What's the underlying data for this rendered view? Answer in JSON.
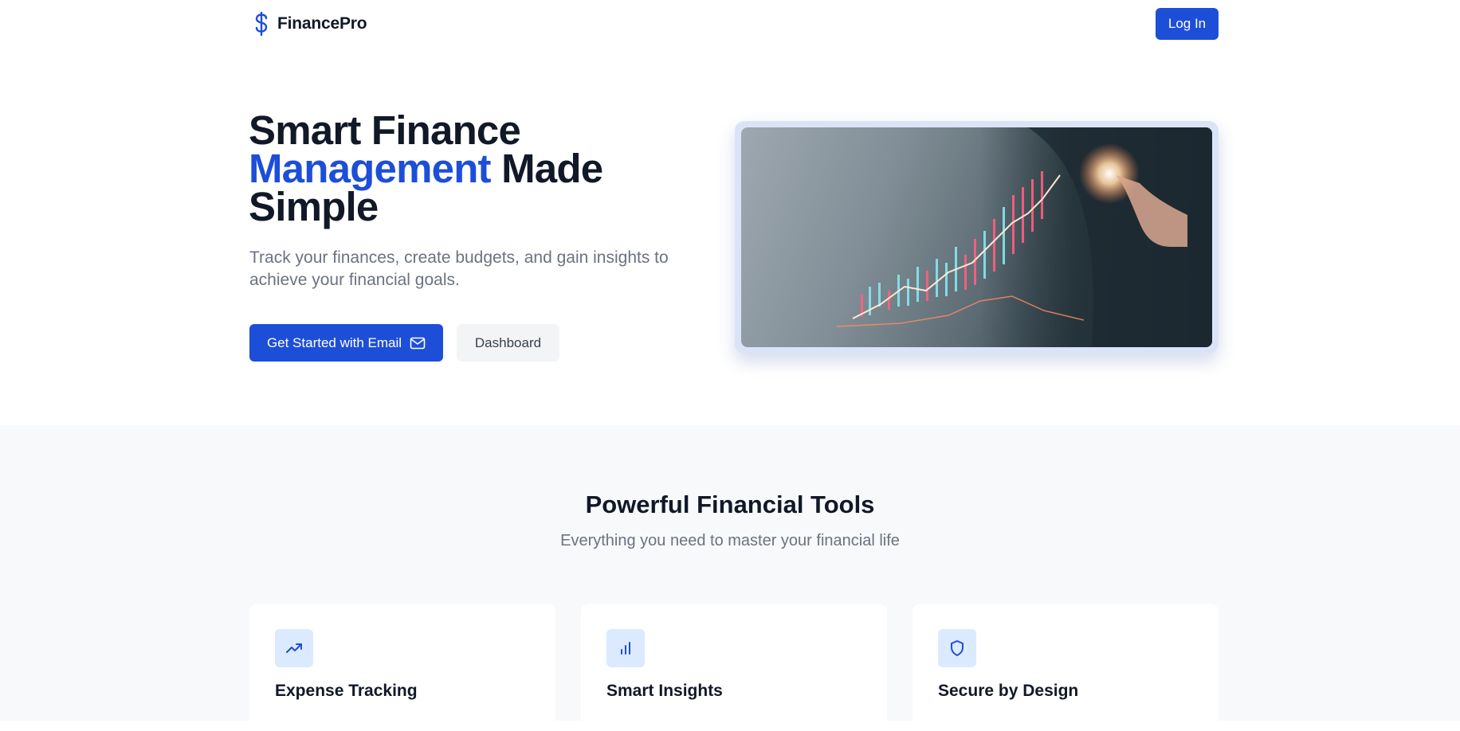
{
  "header": {
    "brand_name": "FinancePro",
    "brand_icon": "dollar-icon",
    "login_label": "Log In"
  },
  "hero": {
    "title_line1": "Smart Finance",
    "title_accent": "Management",
    "title_after_accent": " Made",
    "title_line3": "Simple",
    "subtitle": "Track your finances, create budgets, and gain insights to achieve your financial goals.",
    "primary_button": "Get Started with Email",
    "primary_button_icon": "mail-icon",
    "secondary_button": "Dashboard",
    "image_alt": "Businessman touching rising financial chart"
  },
  "features": {
    "title": "Powerful Financial Tools",
    "subtitle": "Everything you need to master your financial life",
    "cards": [
      {
        "title": "Expense Tracking",
        "icon": "trending-up-icon"
      },
      {
        "title": "Smart Insights",
        "icon": "bar-chart-icon"
      },
      {
        "title": "Secure by Design",
        "icon": "shield-icon"
      }
    ]
  },
  "colors": {
    "brand": "#1d4ed8",
    "heading": "#111827",
    "muted": "#6b7280",
    "section_bg": "#f8f9fb",
    "icon_bg": "#dbeafe"
  }
}
